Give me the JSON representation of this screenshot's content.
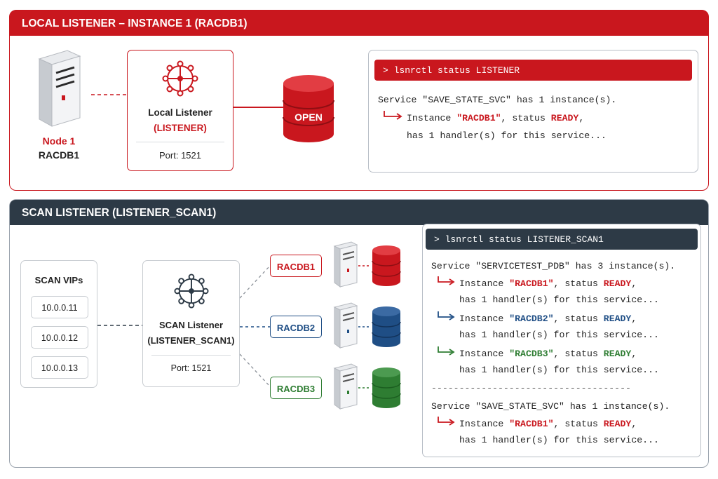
{
  "local_panel": {
    "title": "LOCAL LISTENER – INSTANCE 1 (RACDB1)",
    "node_label": "Node 1",
    "node_name": "RACDB1",
    "listener_title": "Local Listener",
    "listener_name": "(LISTENER)",
    "port": "Port: 1521",
    "db_label": "OPEN",
    "terminal": {
      "prompt": ">",
      "command": "lsnrctl status LISTENER",
      "line1": "Service \"SAVE_STATE_SVC\" has 1 instance(s).",
      "line2_pre": "Instance ",
      "line2_inst": "\"RACDB1\"",
      "line2_mid": ", status ",
      "line2_status": "READY",
      "line2_post": ",",
      "line3": "has 1 handler(s) for this service..."
    }
  },
  "scan_panel": {
    "title": "SCAN LISTENER (LISTENER_SCAN1)",
    "vips_title": "SCAN VIPs",
    "vips": [
      "10.0.0.11",
      "10.0.0.12",
      "10.0.0.13"
    ],
    "listener_title": "SCAN Listener",
    "listener_name": "(LISTENER_SCAN1)",
    "port": "Port: 1521",
    "instances": [
      "RACDB1",
      "RACDB2",
      "RACDB3"
    ],
    "terminal": {
      "prompt": ">",
      "command": "lsnrctl status LISTENER_SCAN1",
      "svc1": "Service \"SERVICETEST_PDB\" has 3 instance(s).",
      "entries": [
        {
          "pre": "Instance ",
          "inst": "\"RACDB1\"",
          "mid": ", status ",
          "status": "READY",
          "post": ",",
          "handler": "has 1 handler(s) for this service..."
        },
        {
          "pre": "Instance ",
          "inst": "\"RACDB2\"",
          "mid": ", status ",
          "status": "READY",
          "post": ",",
          "handler": "has 1 handler(s) for this service..."
        },
        {
          "pre": "Instance ",
          "inst": "\"RACDB3\"",
          "mid": ", status ",
          "status": "READY",
          "post": ",",
          "handler": "has 1 handler(s) for this service..."
        }
      ],
      "divider": "------------------------------------",
      "svc2": "Service \"SAVE_STATE_SVC\" has 1 instance(s).",
      "entry_last": {
        "pre": "Instance ",
        "inst": "\"RACDB1\"",
        "mid": ", status ",
        "status": "READY",
        "post": ",",
        "handler": "has 1 handler(s) for this service..."
      }
    }
  },
  "colors": {
    "oracle_red": "#c9171e",
    "racdb2_blue": "#1f4e85",
    "racdb3_green": "#2e7d32",
    "dark_header": "#2d3a46"
  }
}
